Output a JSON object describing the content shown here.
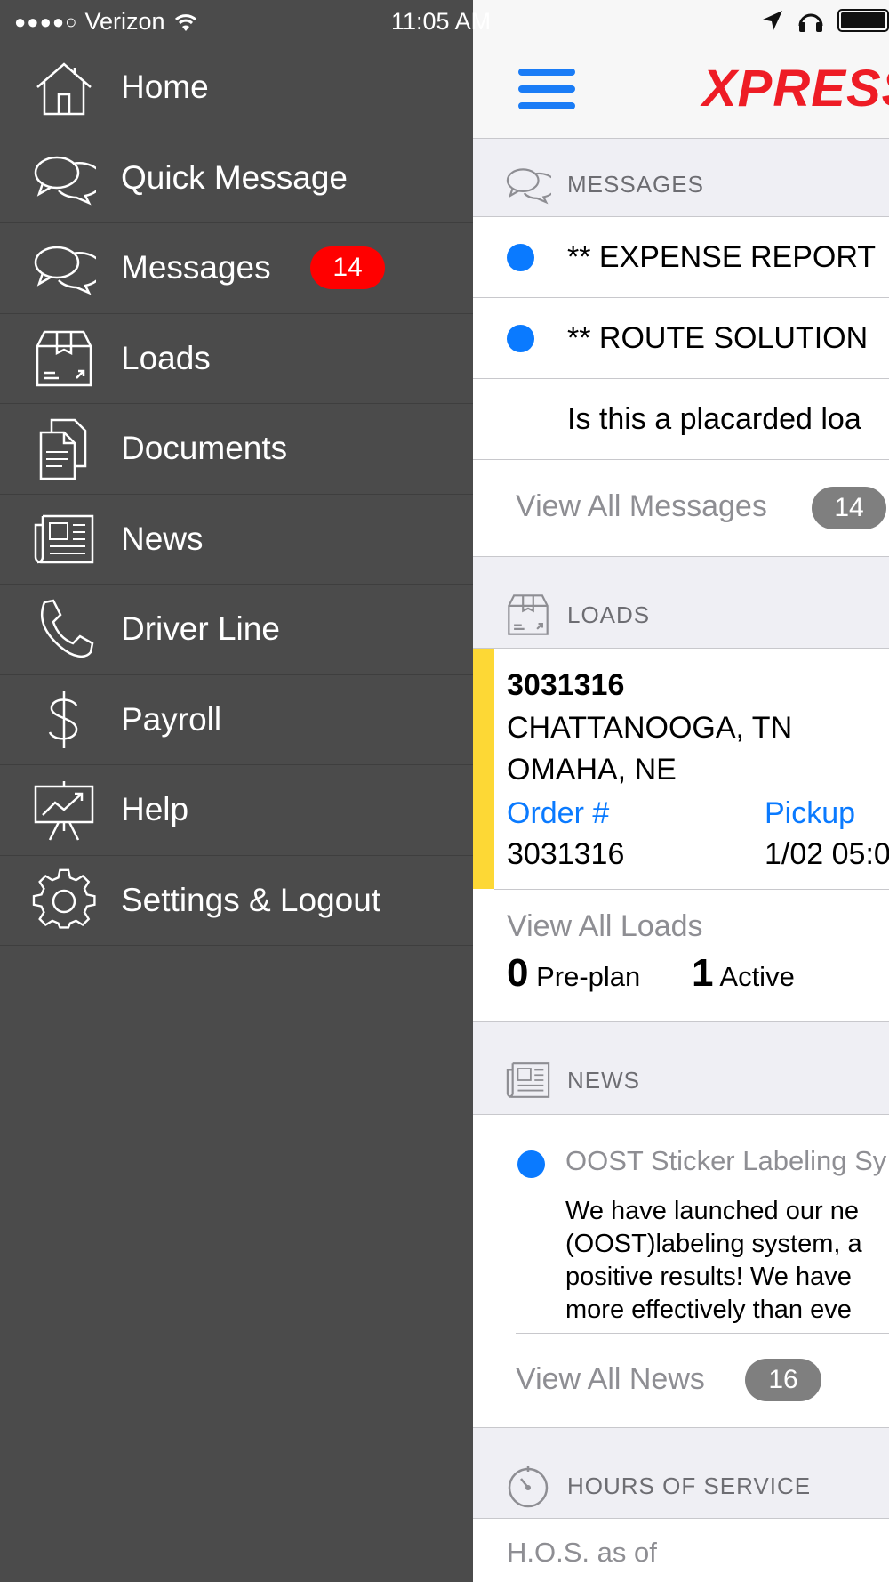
{
  "status_bar": {
    "signal": "●●●●○",
    "carrier": "Verizon",
    "time": "11:05 AM"
  },
  "drawer": {
    "items": [
      {
        "label": "Home",
        "icon": "home-icon"
      },
      {
        "label": "Quick Message",
        "icon": "chat-bubbles-icon"
      },
      {
        "label": "Messages",
        "icon": "chat-bubbles-icon",
        "badge": "14"
      },
      {
        "label": "Loads",
        "icon": "box-icon"
      },
      {
        "label": "Documents",
        "icon": "documents-icon"
      },
      {
        "label": "News",
        "icon": "newspaper-icon"
      },
      {
        "label": "Driver Line",
        "icon": "phone-icon"
      },
      {
        "label": "Payroll",
        "icon": "dollar-icon"
      },
      {
        "label": "Help",
        "icon": "presentation-chart-icon"
      },
      {
        "label": "Settings & Logout",
        "icon": "gear-icon"
      }
    ]
  },
  "header": {
    "logo_text": "XPRESS"
  },
  "messages": {
    "title": "MESSAGES",
    "items": [
      "** EXPENSE REPORT",
      "** ROUTE SOLUTION",
      "Is this a placarded loa"
    ],
    "view_all": "View All Messages",
    "count": "14"
  },
  "loads": {
    "title": "LOADS",
    "load_number": "3031316",
    "origin": "CHATTANOOGA, TN",
    "destination": "OMAHA, NE",
    "order_label": "Order #",
    "order_value": "3031316",
    "pickup_label": "Pickup",
    "pickup_value": "1/02 05:0",
    "view_all": "View All Loads",
    "preplan_count": "0",
    "preplan_label": "Pre-plan",
    "active_count": "1",
    "active_label": "Active"
  },
  "news": {
    "title": "NEWS",
    "item_title": "OOST Sticker Labeling Sy",
    "item_body": [
      "We have launched our ne",
      "(OOST)labeling system, a",
      "positive results! We have",
      "more effectively than eve"
    ],
    "view_all": "View All News",
    "count": "16"
  },
  "hos": {
    "title": "HOURS OF SERVICE",
    "as_of": "H.O.S. as of"
  },
  "colors": {
    "accent_blue": "#0a7aff",
    "drawer_bg": "#4b4b4b",
    "badge_red": "#ff0000",
    "load_bar": "#fdd835",
    "logo_red": "#ee1c25"
  }
}
